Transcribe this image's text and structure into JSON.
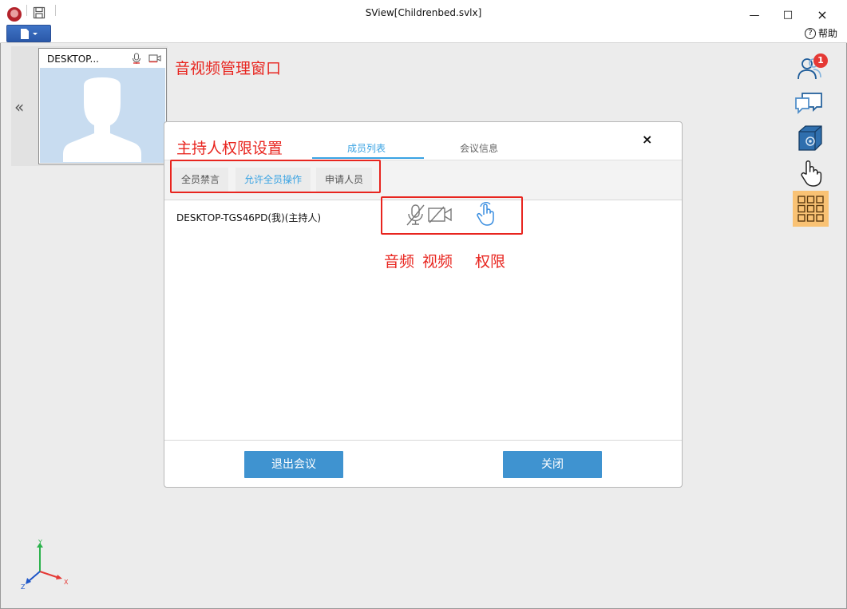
{
  "window": {
    "title": "SView[Childrenbed.svlx]",
    "help_label": "帮助",
    "help_glyph": "?",
    "minimize_glyph": "—",
    "maximize_glyph": "□",
    "close_glyph": "×"
  },
  "toolbar": {
    "file_menu_icon": "document-icon"
  },
  "video_panel": {
    "collapse_glyph": "«",
    "tile_name": "DESKTOP...",
    "mic_icon": "microphone-icon",
    "camera_icon": "camera-icon",
    "avatar_icon": "person-silhouette-icon"
  },
  "annotations": {
    "video_window": "音视频管理窗口",
    "host_settings": "主持人权限设置",
    "audio": "音频",
    "video": "视频",
    "permission": "权限"
  },
  "dialog": {
    "close_glyph": "×",
    "tabs": [
      {
        "label": "成员列表",
        "active": true
      },
      {
        "label": "会议信息",
        "active": false
      }
    ],
    "actions": [
      {
        "label": "全员禁言",
        "active": false
      },
      {
        "label": "允许全员操作",
        "active": true
      },
      {
        "label": "申请人员",
        "active": false
      }
    ],
    "members": [
      {
        "name": "DESKTOP-TGS46PD(我)(主持人)",
        "audio": "muted",
        "video": "off",
        "permission": "granted"
      }
    ],
    "buttons": {
      "leave": "退出会议",
      "close": "关闭"
    }
  },
  "right_toolbar": {
    "participants_badge": "1",
    "items": [
      "participants-icon",
      "chat-icon",
      "model-settings-icon",
      "hand-icon",
      "grid-icon"
    ]
  },
  "axis": {
    "x": "X",
    "y": "Y",
    "z": "Z"
  },
  "colors": {
    "accent_blue": "#3f93d0",
    "tab_active": "#3aa3e3",
    "annotation_red": "#e8251f",
    "highlight_orange": "#f9c274"
  }
}
